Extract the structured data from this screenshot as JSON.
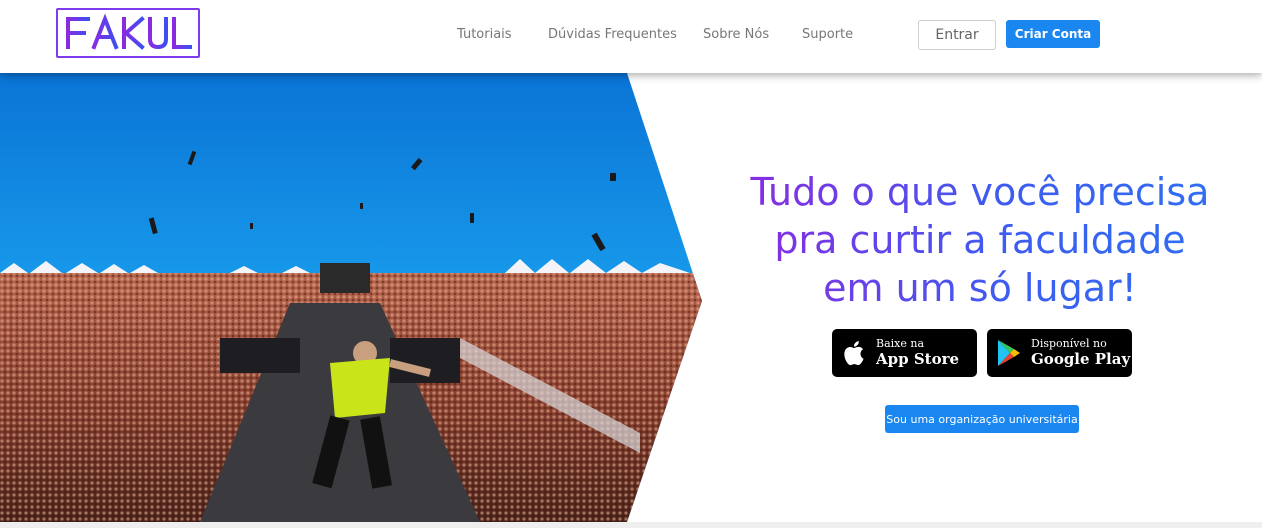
{
  "header": {
    "logo_text": "FAKUL",
    "nav": [
      {
        "label": "Tutoriais"
      },
      {
        "label": "Dúvidas Frequentes"
      },
      {
        "label": "Sobre Nós"
      },
      {
        "label": "Suporte"
      }
    ],
    "login_label": "Entrar",
    "signup_label": "Criar Conta"
  },
  "hero": {
    "headline_lines": [
      "Tudo o que você precisa",
      "pra curtir a faculdade",
      "em um só lugar!"
    ],
    "app_store": {
      "sub": "Baixe na",
      "main": "App Store",
      "icon": "apple-icon"
    },
    "google_play": {
      "sub": "Disponível no",
      "main": "Google Play",
      "icon": "google-play-icon"
    },
    "org_button_label": "Sou uma organização universitária"
  },
  "colors": {
    "brand_purple": "#7d3cf0",
    "accent_blue": "#1a86f0",
    "headline_gradient": [
      "#8a2be2",
      "#2f6ff2"
    ]
  }
}
